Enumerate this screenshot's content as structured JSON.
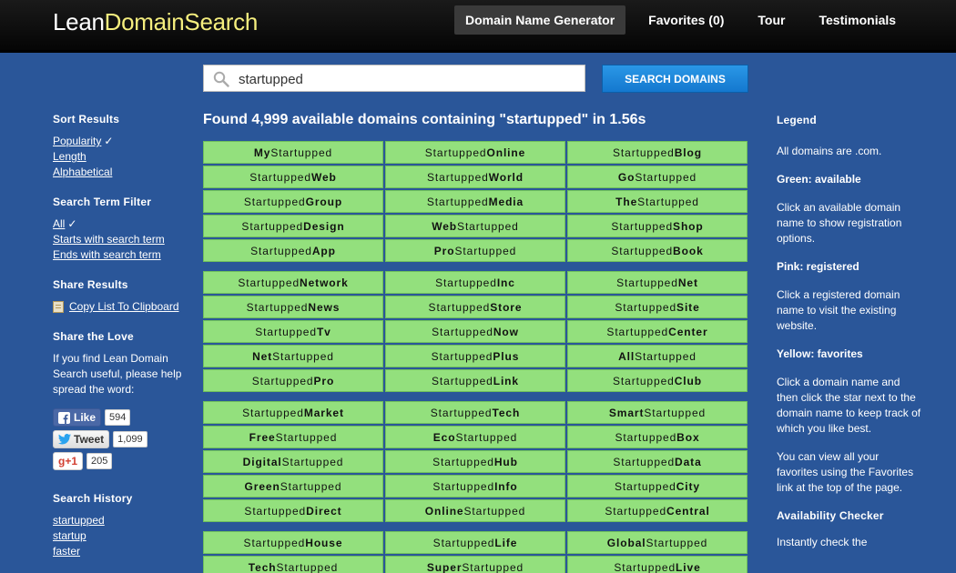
{
  "header": {
    "logo_lean": "Lean",
    "logo_ds": "DomainSearch",
    "nav": [
      "Domain Name Generator",
      "Favorites (0)",
      "Tour",
      "Testimonials"
    ]
  },
  "search": {
    "value": "startupped",
    "placeholder": "",
    "button": "SEARCH DOMAINS"
  },
  "results": {
    "found_text": "Found 4,999 available domains containing \"startupped\" in 1.56s",
    "groups": [
      [
        [
          "My",
          "Startupped",
          "prefix"
        ],
        [
          "Startupped",
          "Online",
          "suffix"
        ],
        [
          "Startupped",
          "Blog",
          "suffix"
        ],
        [
          "Startupped",
          "Web",
          "suffix"
        ],
        [
          "Startupped",
          "World",
          "suffix"
        ],
        [
          "Go",
          "Startupped",
          "prefix"
        ],
        [
          "Startupped",
          "Group",
          "suffix"
        ],
        [
          "Startupped",
          "Media",
          "suffix"
        ],
        [
          "The",
          "Startupped",
          "prefix"
        ],
        [
          "Startupped",
          "Design",
          "suffix"
        ],
        [
          "Web",
          "Startupped",
          "prefix"
        ],
        [
          "Startupped",
          "Shop",
          "suffix"
        ],
        [
          "Startupped",
          "App",
          "suffix"
        ],
        [
          "Pro",
          "Startupped",
          "prefix"
        ],
        [
          "Startupped",
          "Book",
          "suffix"
        ]
      ],
      [
        [
          "Startupped",
          "Network",
          "suffix"
        ],
        [
          "Startupped",
          "Inc",
          "suffix"
        ],
        [
          "Startupped",
          "Net",
          "suffix"
        ],
        [
          "Startupped",
          "News",
          "suffix"
        ],
        [
          "Startupped",
          "Store",
          "suffix"
        ],
        [
          "Startupped",
          "Site",
          "suffix"
        ],
        [
          "Startupped",
          "Tv",
          "suffix"
        ],
        [
          "Startupped",
          "Now",
          "suffix"
        ],
        [
          "Startupped",
          "Center",
          "suffix"
        ],
        [
          "Net",
          "Startupped",
          "prefix"
        ],
        [
          "Startupped",
          "Plus",
          "suffix"
        ],
        [
          "All",
          "Startupped",
          "prefix"
        ],
        [
          "Startupped",
          "Pro",
          "suffix"
        ],
        [
          "Startupped",
          "Link",
          "suffix"
        ],
        [
          "Startupped",
          "Club",
          "suffix"
        ]
      ],
      [
        [
          "Startupped",
          "Market",
          "suffix"
        ],
        [
          "Startupped",
          "Tech",
          "suffix"
        ],
        [
          "Smart",
          "Startupped",
          "prefix"
        ],
        [
          "Free",
          "Startupped",
          "prefix"
        ],
        [
          "Eco",
          "Startupped",
          "prefix"
        ],
        [
          "Startupped",
          "Box",
          "suffix"
        ],
        [
          "Digital",
          "Startupped",
          "prefix"
        ],
        [
          "Startupped",
          "Hub",
          "suffix"
        ],
        [
          "Startupped",
          "Data",
          "suffix"
        ],
        [
          "Green",
          "Startupped",
          "prefix"
        ],
        [
          "Startupped",
          "Info",
          "suffix"
        ],
        [
          "Startupped",
          "City",
          "suffix"
        ],
        [
          "Startupped",
          "Direct",
          "suffix"
        ],
        [
          "Online",
          "Startupped",
          "prefix"
        ],
        [
          "Startupped",
          "Central",
          "suffix"
        ]
      ],
      [
        [
          "Startupped",
          "House",
          "suffix"
        ],
        [
          "Startupped",
          "Life",
          "suffix"
        ],
        [
          "Global",
          "Startupped",
          "prefix"
        ],
        [
          "Tech",
          "Startupped",
          "prefix"
        ],
        [
          "Super",
          "Startupped",
          "prefix"
        ],
        [
          "Startupped",
          "Live",
          "suffix"
        ]
      ]
    ]
  },
  "left": {
    "sort_title": "Sort Results",
    "sort_items": [
      "Popularity",
      "Length",
      "Alphabetical"
    ],
    "check": "✓",
    "filter_title": "Search Term Filter",
    "filter_items": [
      "All",
      "Starts with search term",
      "Ends with search term"
    ],
    "share_title": "Share Results",
    "copy_label": "Copy List To Clipboard",
    "love_title": "Share the Love",
    "love_text": "If you find Lean Domain Search useful, please help spread the word:",
    "fb_label": "Like",
    "fb_count": "594",
    "tw_label": "Tweet",
    "tw_count": "1,099",
    "gp_label": "g+1",
    "gp_count": "205",
    "history_title": "Search History",
    "history_items": [
      "startupped",
      "startup",
      "faster"
    ]
  },
  "legend": {
    "title": "Legend",
    "all_com": "All domains are .com.",
    "green_label": "Green: available",
    "green_text": "Click an available domain name to show registration options.",
    "pink_label": "Pink: registered",
    "pink_text": "Click a registered domain name to visit the existing website.",
    "yellow_label": "Yellow: favorites",
    "yellow_text": "Click a domain name and then click the star next to the domain name to keep track of which you like best.",
    "fav_text": "You can view all your favorites using the Favorites link at the top of the page.",
    "checker_title": "Availability Checker",
    "checker_text": "Instantly check the"
  },
  "colors": {
    "background": "#2a5699",
    "available": "#93e07d",
    "button": "#1e88dc",
    "logo_accent": "#f5ee7e"
  }
}
